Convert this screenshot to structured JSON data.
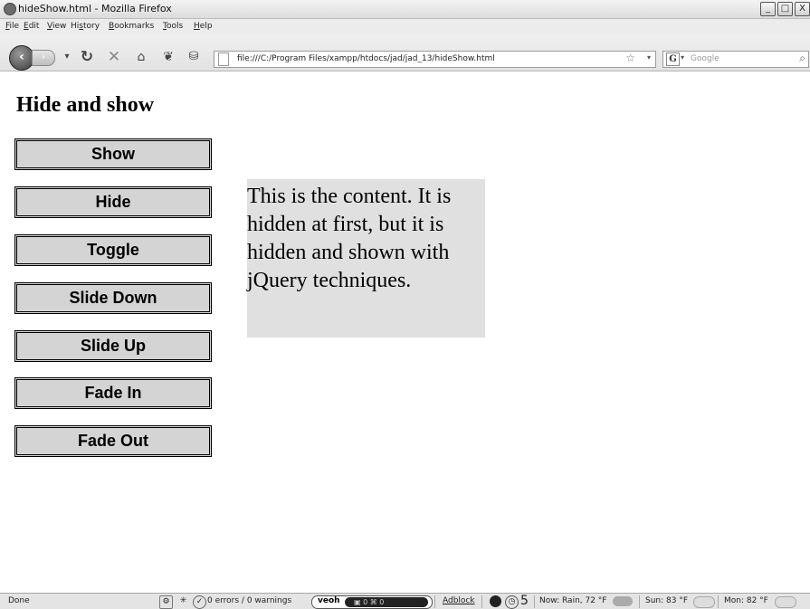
{
  "window": {
    "title": "hideShow.html - Mozilla Firefox",
    "controls": [
      "_",
      "□",
      "X"
    ]
  },
  "menubar": {
    "items": [
      {
        "label": "File",
        "key": "F",
        "rest": "ile"
      },
      {
        "label": "Edit",
        "key": "E",
        "rest": "dit"
      },
      {
        "label": "View",
        "key": "V",
        "rest": "iew"
      },
      {
        "label": "History",
        "pre": "Hi",
        "key": "s",
        "rest": "tory"
      },
      {
        "label": "Bookmarks",
        "key": "B",
        "rest": "ookmarks"
      },
      {
        "label": "Tools",
        "key": "T",
        "rest": "ools"
      },
      {
        "label": "Help",
        "key": "H",
        "rest": "elp"
      }
    ]
  },
  "navbar": {
    "back_glyph": "‹",
    "forward_glyph": "›",
    "url": "file:///C:/Program Files/xampp/htdocs/jad/jad_13/hideShow.html",
    "bookmark_glyph": "☆",
    "dropdown_glyph": "▾",
    "search_engine_glyph": "G",
    "search_placeholder": "Google"
  },
  "page": {
    "heading": "Hide and show",
    "buttons": [
      "Show",
      "Hide",
      "Toggle",
      "Slide Down",
      "Slide Up",
      "Fade In",
      "Fade Out"
    ],
    "content_text": "This is the content. It is hidden at first, but it is hidden and shown with jQuery techniques."
  },
  "statusbar": {
    "status": "Done",
    "errors": "0 errors / 0 warnings",
    "veoh_label": "veoh",
    "veoh_counts": "▣ 0  ⌘ 0",
    "adblock": "Adblock",
    "count": "5",
    "weather_now": "Now: Rain, 72 °F",
    "weather_sun": "Sun: 83 °F",
    "weather_mon": "Mon: 82 °F"
  }
}
